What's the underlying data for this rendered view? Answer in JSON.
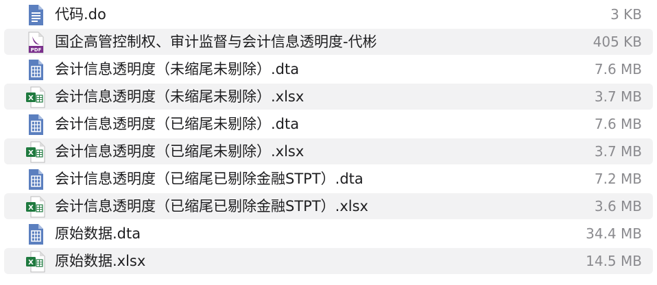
{
  "files": [
    {
      "name": "代码.do",
      "size": "3 KB",
      "icon": "doc-text-icon"
    },
    {
      "name": "国企高管控制权、审计监督与会计信息透明度-代彬",
      "size": "405 KB",
      "icon": "pdf-icon"
    },
    {
      "name": "会计信息透明度（未缩尾未剔除）.dta",
      "size": "7.6 MB",
      "icon": "data-file-icon"
    },
    {
      "name": "会计信息透明度（未缩尾未剔除）.xlsx",
      "size": "3.7 MB",
      "icon": "excel-icon"
    },
    {
      "name": "会计信息透明度（已缩尾未剔除）.dta",
      "size": "7.6 MB",
      "icon": "data-file-icon"
    },
    {
      "name": "会计信息透明度（已缩尾未剔除）.xlsx",
      "size": "3.7 MB",
      "icon": "excel-icon"
    },
    {
      "name": "会计信息透明度（已缩尾已剔除金融STPT）.dta",
      "size": "7.2 MB",
      "icon": "data-file-icon"
    },
    {
      "name": "会计信息透明度（已缩尾已剔除金融STPT）.xlsx",
      "size": "3.6 MB",
      "icon": "excel-icon"
    },
    {
      "name": "原始数据.dta",
      "size": "34.4 MB",
      "icon": "data-file-icon"
    },
    {
      "name": "原始数据.xlsx",
      "size": "14.5 MB",
      "icon": "excel-icon"
    }
  ],
  "colors": {
    "row_alt": "#f2f2f3",
    "text": "#1d1d1f",
    "size_text": "#8a8a8e",
    "doc_blue": "#5b7fbf",
    "pdf_purple": "#7a2f8c",
    "excel_green": "#1f7a3f"
  }
}
